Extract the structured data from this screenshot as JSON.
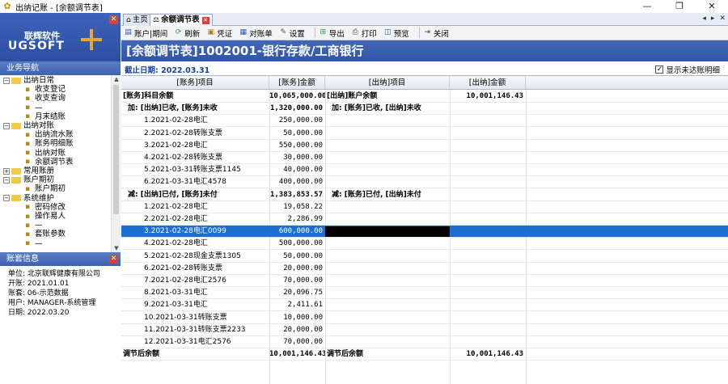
{
  "window": {
    "title": "出纳记账 - [余额调节表]",
    "minimize": "—",
    "restore": "❐",
    "close": "✕"
  },
  "logo": {
    "brand_cn": "联辉软件",
    "brand_en": "UGSOFT"
  },
  "nav": {
    "heading": "业务导航",
    "tree": [
      {
        "label": "出纳日常",
        "level": 0,
        "type": "folder",
        "toggle": "−"
      },
      {
        "label": "收支登记",
        "level": 2,
        "type": "leaf"
      },
      {
        "label": "收支查询",
        "level": 2,
        "type": "leaf"
      },
      {
        "label": "—",
        "level": 2,
        "type": "leaf"
      },
      {
        "label": "月末结账",
        "level": 2,
        "type": "leaf"
      },
      {
        "label": "出纳对账",
        "level": 0,
        "type": "folder",
        "toggle": "−"
      },
      {
        "label": "出纳流水账",
        "level": 2,
        "type": "leaf"
      },
      {
        "label": "账务明细账",
        "level": 2,
        "type": "leaf"
      },
      {
        "label": "出纳对账",
        "level": 2,
        "type": "leaf"
      },
      {
        "label": "余额调节表",
        "level": 2,
        "type": "leaf"
      },
      {
        "label": "常用账册",
        "level": 0,
        "type": "folder",
        "toggle": "+"
      },
      {
        "label": "账户期初",
        "level": 0,
        "type": "folder",
        "toggle": "−"
      },
      {
        "label": "账户期初",
        "level": 2,
        "type": "leaf"
      },
      {
        "label": "系统维护",
        "level": 0,
        "type": "folder",
        "toggle": "−"
      },
      {
        "label": "密码修改",
        "level": 2,
        "type": "leaf"
      },
      {
        "label": "操作易人",
        "level": 2,
        "type": "leaf"
      },
      {
        "label": "—",
        "level": 2,
        "type": "leaf"
      },
      {
        "label": "套账参数",
        "level": 2,
        "type": "leaf"
      },
      {
        "label": "—",
        "level": 2,
        "type": "leaf"
      }
    ]
  },
  "account_info": {
    "heading": "账套信息",
    "lines": [
      "单位: 北京联辉健康有限公司",
      "开账: 2021.01.01",
      "账套: 06-示范数据",
      "用户: MANAGER-系统管理",
      "日期: 2022.03.20"
    ]
  },
  "tabs": [
    {
      "label": "主页",
      "icon": "home-icon",
      "active": false
    },
    {
      "label": "余额调节表",
      "icon": "ledger-icon",
      "active": true
    }
  ],
  "tab_nav": {
    "prev": "◂",
    "next": "▸",
    "close": "✕"
  },
  "toolbar": [
    {
      "label": "账户|期间",
      "icon": "account-icon",
      "glyph": "▤"
    },
    {
      "label": "刷新",
      "icon": "refresh-icon",
      "glyph": "⟳"
    },
    {
      "label": "凭证",
      "icon": "voucher-icon",
      "glyph": "▣"
    },
    {
      "label": "对账单",
      "icon": "statement-icon",
      "glyph": "▦"
    },
    {
      "label": "设置",
      "icon": "settings-icon",
      "glyph": "✎"
    },
    {
      "label": "导出",
      "icon": "export-icon",
      "glyph": "⊞"
    },
    {
      "label": "打印",
      "icon": "print-icon",
      "glyph": "⎙"
    },
    {
      "label": "预览",
      "icon": "preview-icon",
      "glyph": "◫"
    },
    {
      "label": "关闭",
      "icon": "close-icon",
      "glyph": "⇥"
    }
  ],
  "banner": {
    "title": "[余额调节表]1002001-银行存款/工商银行"
  },
  "datebar": {
    "date": "截止日期: 2022.03.31",
    "checkbox_label": "显示未达账明细",
    "checkbox_checked": "✓"
  },
  "grid": {
    "headers": [
      "[账务]项目",
      "[账务]金额",
      "[出纳]项目",
      "[出纳]金额"
    ],
    "rows": [
      {
        "c1": "[账务]科目余额",
        "c2": "10,065,000.00",
        "c3": "[出纳]账户余额",
        "c4": "10,001,146.43",
        "bold": true,
        "indent": 0
      },
      {
        "c1": "加: [出纳]已收, [账务]未收",
        "c2": "1,320,000.00",
        "c3": "加: [账务]已收, [出纳]未收",
        "c4": "",
        "bold": true,
        "indent": 1
      },
      {
        "c1": "1.2021-02-28电汇",
        "c2": "250,000.00",
        "c3": "",
        "c4": "",
        "indent": 2
      },
      {
        "c1": "2.2021-02-28转账支票",
        "c2": "50,000.00",
        "c3": "",
        "c4": "",
        "indent": 2
      },
      {
        "c1": "3.2021-02-28电汇",
        "c2": "550,000.00",
        "c3": "",
        "c4": "",
        "indent": 2
      },
      {
        "c1": "4.2021-02-28转账支票",
        "c2": "30,000.00",
        "c3": "",
        "c4": "",
        "indent": 2
      },
      {
        "c1": "5.2021-03-31转账支票1145",
        "c2": "40,000.00",
        "c3": "",
        "c4": "",
        "indent": 2
      },
      {
        "c1": "6.2021-03-31电汇4578",
        "c2": "400,000.00",
        "c3": "",
        "c4": "",
        "indent": 2
      },
      {
        "c1": "减: [出纳]已付, [账务]未付",
        "c2": "1,383,853.57",
        "c3": "减: [账务]已付, [出纳]未付",
        "c4": "",
        "bold": true,
        "indent": 1
      },
      {
        "c1": "1.2021-02-28电汇",
        "c2": "19,058.22",
        "c3": "",
        "c4": "",
        "indent": 2
      },
      {
        "c1": "2.2021-02-28电汇",
        "c2": "2,286.99",
        "c3": "",
        "c4": "",
        "indent": 2
      },
      {
        "c1": "3.2021-02-28电汇0099",
        "c2": "600,000.00",
        "c3": "",
        "c4": "",
        "indent": 2,
        "selected": true
      },
      {
        "c1": "4.2021-02-28电汇",
        "c2": "500,000.00",
        "c3": "",
        "c4": "",
        "indent": 2
      },
      {
        "c1": "5.2021-02-28现金支票1305",
        "c2": "50,000.00",
        "c3": "",
        "c4": "",
        "indent": 2
      },
      {
        "c1": "6.2021-02-28转账支票",
        "c2": "20,000.00",
        "c3": "",
        "c4": "",
        "indent": 2
      },
      {
        "c1": "7.2021-02-28电汇2576",
        "c2": "70,000.00",
        "c3": "",
        "c4": "",
        "indent": 2
      },
      {
        "c1": "8.2021-03-31电汇",
        "c2": "20,096.75",
        "c3": "",
        "c4": "",
        "indent": 2
      },
      {
        "c1": "9.2021-03-31电汇",
        "c2": "2,411.61",
        "c3": "",
        "c4": "",
        "indent": 2
      },
      {
        "c1": "10.2021-03-31转账支票",
        "c2": "10,000.00",
        "c3": "",
        "c4": "",
        "indent": 2
      },
      {
        "c1": "11.2021-03-31转账支票2233",
        "c2": "20,000.00",
        "c3": "",
        "c4": "",
        "indent": 2
      },
      {
        "c1": "12.2021-03-31电汇2576",
        "c2": "70,000.00",
        "c3": "",
        "c4": "",
        "indent": 2
      },
      {
        "c1": "调节后余额",
        "c2": "10,001,146.43",
        "c3": "调节后余额",
        "c4": "10,001,146.43",
        "bold": true,
        "indent": 0
      }
    ]
  }
}
